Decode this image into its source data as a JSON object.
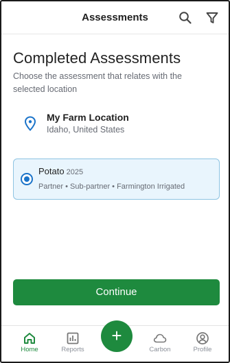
{
  "header": {
    "title": "Assessments",
    "search_icon": "search-icon",
    "filter_icon": "filter-icon"
  },
  "main": {
    "title": "Completed Assessments",
    "subtitle": "Choose the assessment that relates with the selected location"
  },
  "location": {
    "icon": "map-pin-icon",
    "name": "My Farm Location",
    "region": "Idaho, United States"
  },
  "assessments": [
    {
      "crop": "Potato",
      "year": "2025",
      "details": "Partner • Sub-partner • Farmington Irrigated",
      "selected": true
    }
  ],
  "continue_label": "Continue",
  "fab_label": "+",
  "nav": {
    "items": [
      {
        "label": "Home",
        "icon": "home-icon",
        "active": true
      },
      {
        "label": "Reports",
        "icon": "reports-icon",
        "active": false
      },
      {
        "label": "Carbon",
        "icon": "cloud-icon",
        "active": false
      },
      {
        "label": "Profile",
        "icon": "profile-icon",
        "active": false
      }
    ]
  },
  "colors": {
    "primary_green": "#1e8a3e",
    "selection_blue": "#1a73c9",
    "card_background": "#e9f5fd",
    "card_border": "#8dc3e2"
  }
}
